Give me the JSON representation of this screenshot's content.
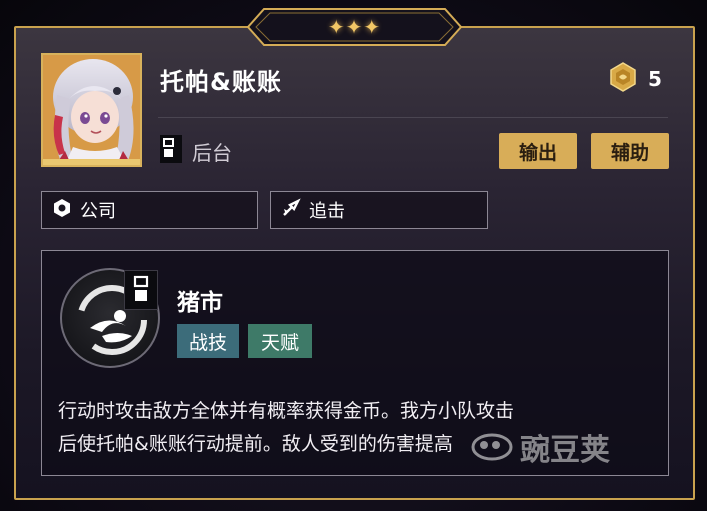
{
  "header": {
    "stars": "✦✦✦"
  },
  "character": {
    "name": "托帕&账账",
    "path": "后台",
    "cost": "5"
  },
  "roles": [
    "输出",
    "辅助"
  ],
  "traits": [
    {
      "label": "公司",
      "icon": "company-icon"
    },
    {
      "label": "追击",
      "icon": "follow-up-icon"
    }
  ],
  "skill": {
    "name": "猪市",
    "tags": [
      "战技",
      "天赋"
    ],
    "description_line1": "行动时攻击敌方全体并有概率获得金币。我方小队攻击",
    "description_line2": "后使托帕&账账行动提前。敌人受到的伤害提高"
  },
  "watermark": {
    "text": "豌豆荚"
  },
  "colors": {
    "gold": "#d8ad58",
    "tag_skill": "#3c6c7a",
    "tag_talent": "#3e7a68",
    "border": "#c9a24e"
  }
}
